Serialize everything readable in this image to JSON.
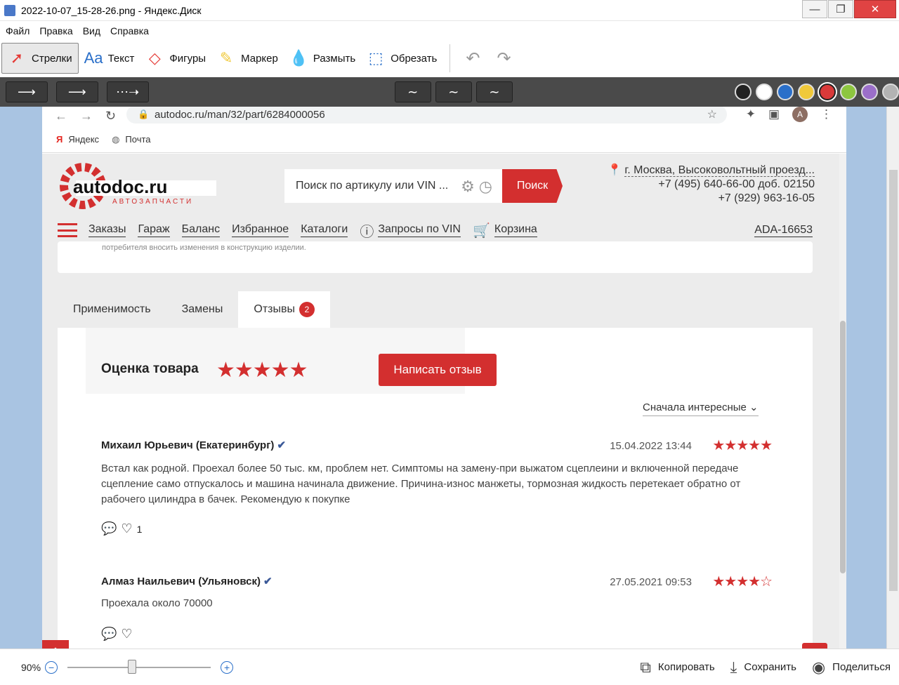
{
  "window": {
    "title": "2022-10-07_15-28-26.png - Яндекс.Диск"
  },
  "menu": [
    "Файл",
    "Правка",
    "Вид",
    "Справка"
  ],
  "toolbar": {
    "tools": [
      {
        "label": "Стрелки",
        "icon": "arrow-icon"
      },
      {
        "label": "Текст",
        "icon": "text-icon"
      },
      {
        "label": "Фигуры",
        "icon": "shapes-icon"
      },
      {
        "label": "Маркер",
        "icon": "marker-icon"
      },
      {
        "label": "Размыть",
        "icon": "blur-icon"
      },
      {
        "label": "Обрезать",
        "icon": "crop-icon"
      }
    ]
  },
  "palette": [
    "#222222",
    "#ffffff",
    "#2a6fc9",
    "#f0c93a",
    "#d93a3a",
    "#8dc63f",
    "#9b6fc9",
    "#b3b3b3"
  ],
  "browser": {
    "url": "autodoc.ru/man/32/part/6284000056",
    "bookmarks": [
      "Яндекс",
      "Почта"
    ],
    "avatar": "A"
  },
  "site": {
    "logo": {
      "name": "autodoc.ru",
      "sub": "АВТОЗАПЧАСТИ"
    },
    "search": {
      "placeholder": "Поиск по артикулу или VIN ...",
      "button": "Поиск"
    },
    "contact": {
      "city": "г. Москва, Высоковольтный проезд...",
      "phone1": "+7 (495) 640-66-00 доб. 02150",
      "phone2": "+7 (929) 963-16-05"
    },
    "nav": [
      "Заказы",
      "Гараж",
      "Баланс",
      "Избранное",
      "Каталоги",
      "Запросы по VIN",
      "Корзина"
    ],
    "account": "ADA-16653",
    "info_text": "потребителя вносить изменения в конструкцию изделии.",
    "tabs": [
      {
        "label": "Применимость"
      },
      {
        "label": "Замены"
      },
      {
        "label": "Отзывы",
        "badge": "2"
      }
    ],
    "rating": {
      "label": "Оценка товара",
      "value": 4.5,
      "max": 5
    },
    "write_review": "Написать отзыв",
    "sort": "Сначала интересные",
    "reviews": [
      {
        "author": "Михаил Юрьевич (Екатеринбург)",
        "date": "15.04.2022 13:44",
        "stars": 5,
        "text": "Встал как родной. Проехал более 50 тыс. км, проблем нет. Симптомы на замену-при выжатом сцеплеини и включенной передаче сцепление само отпускалось и машина начинала движение. Причина-износ манжеты, тормозная жидкость перетекает обратно от рабочего цилиндра в бачек. Рекомендую к покупке",
        "likes": "1"
      },
      {
        "author": "Алмаз Наильевич (Ульяновск)",
        "date": "27.05.2021 09:53",
        "stars": 4,
        "text": "Проехала около 70000",
        "likes": ""
      }
    ]
  },
  "status": {
    "zoom": "90%",
    "zoom_level": 0.45,
    "copy": "Копировать",
    "save": "Сохранить",
    "share": "Поделиться"
  }
}
